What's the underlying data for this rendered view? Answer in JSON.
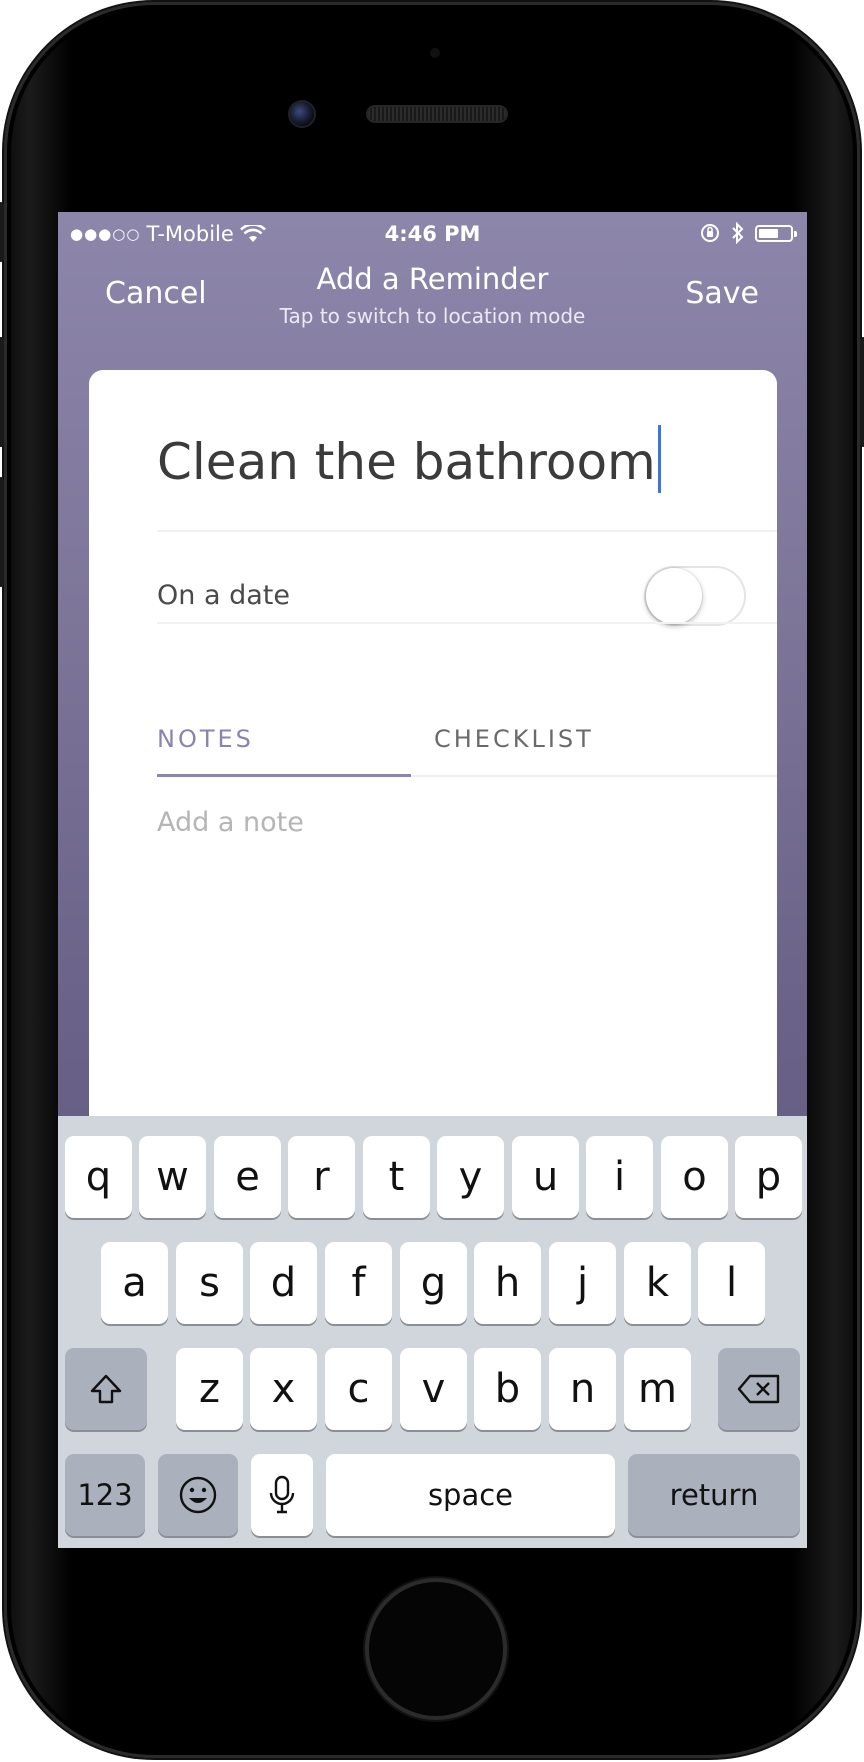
{
  "status_bar": {
    "signal": "●●●○○",
    "carrier": "T-Mobile",
    "time": "4:46 PM"
  },
  "nav": {
    "cancel_label": "Cancel",
    "title": "Add a Reminder",
    "subtitle": "Tap to switch to location mode",
    "save_label": "Save"
  },
  "reminder": {
    "title": "Clean the bathroom",
    "date_label": "On a date",
    "date_enabled": false,
    "tabs": [
      "NOTES",
      "CHECKLIST"
    ],
    "active_tab": "NOTES",
    "note_placeholder": "Add a note"
  },
  "keyboard": {
    "row1": [
      "q",
      "w",
      "e",
      "r",
      "t",
      "y",
      "u",
      "i",
      "o",
      "p"
    ],
    "row2": [
      "a",
      "s",
      "d",
      "f",
      "g",
      "h",
      "j",
      "k",
      "l"
    ],
    "row3": [
      "z",
      "x",
      "c",
      "v",
      "b",
      "n",
      "m"
    ],
    "numbers_label": "123",
    "space_label": "space",
    "return_label": "return"
  },
  "colors": {
    "header_top": "#8d86ab",
    "accent": "#8b84b0",
    "caret": "#3b76e0"
  }
}
